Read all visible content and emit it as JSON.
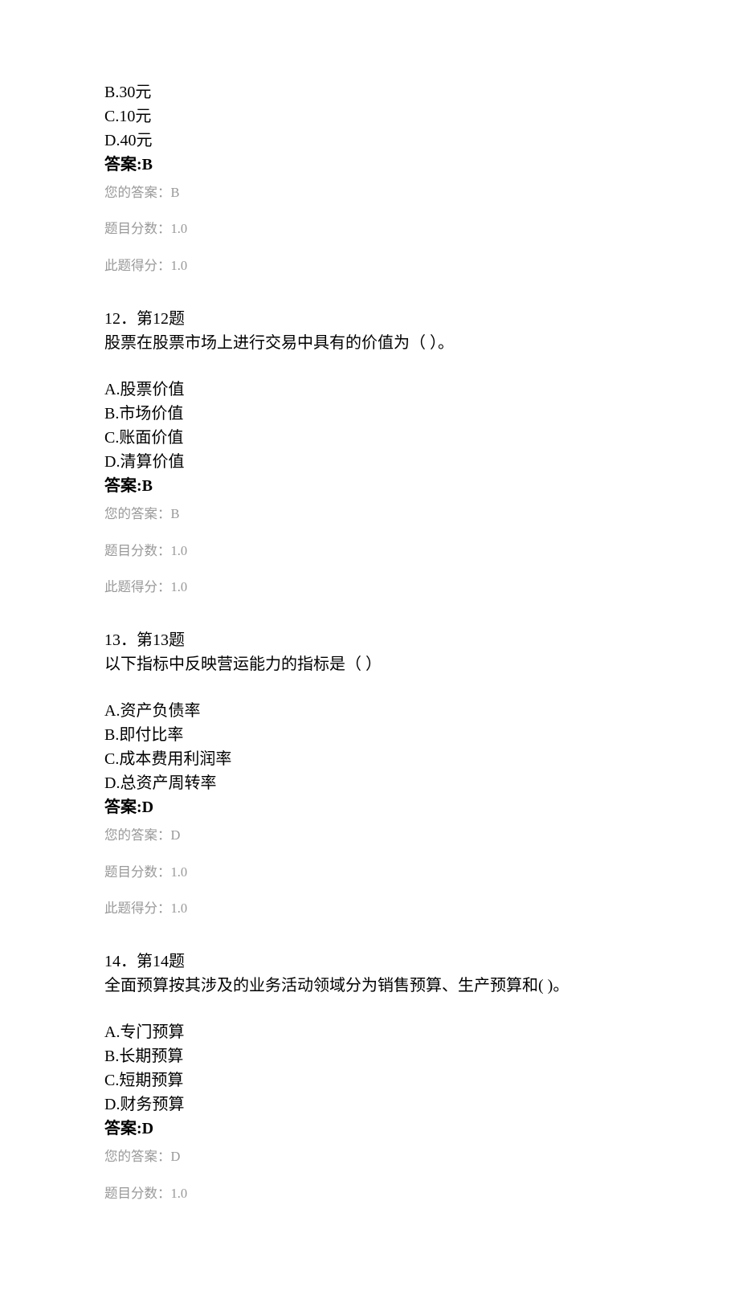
{
  "q11_tail": {
    "options": {
      "b": "B.30元",
      "c": "C.10元",
      "d": "D.40元"
    },
    "answer": "答案:B",
    "your_answer": "您的答案：B",
    "score_full": "题目分数：1.0",
    "score_got": "此题得分：1.0"
  },
  "q12": {
    "header": "12．第12题",
    "stem": "股票在股票市场上进行交易中具有的价值为（ ）。",
    "options": {
      "a": "A.股票价值",
      "b": "B.市场价值",
      "c": "C.账面价值",
      "d": "D.清算价值"
    },
    "answer": "答案:B",
    "your_answer": "您的答案：B",
    "score_full": "题目分数：1.0",
    "score_got": "此题得分：1.0"
  },
  "q13": {
    "header": "13．第13题",
    "stem": "以下指标中反映营运能力的指标是（ ）",
    "options": {
      "a": "A.资产负债率",
      "b": "B.即付比率",
      "c": "C.成本费用利润率",
      "d": "D.总资产周转率"
    },
    "answer": "答案:D",
    "your_answer": "您的答案：D",
    "score_full": "题目分数：1.0",
    "score_got": "此题得分：1.0"
  },
  "q14": {
    "header": "14．第14题",
    "stem": "全面预算按其涉及的业务活动领域分为销售预算、生产预算和( )。",
    "options": {
      "a": "A.专门预算",
      "b": "B.长期预算",
      "c": "C.短期预算",
      "d": "D.财务预算"
    },
    "answer": "答案:D",
    "your_answer": "您的答案：D",
    "score_full": "题目分数：1.0"
  }
}
